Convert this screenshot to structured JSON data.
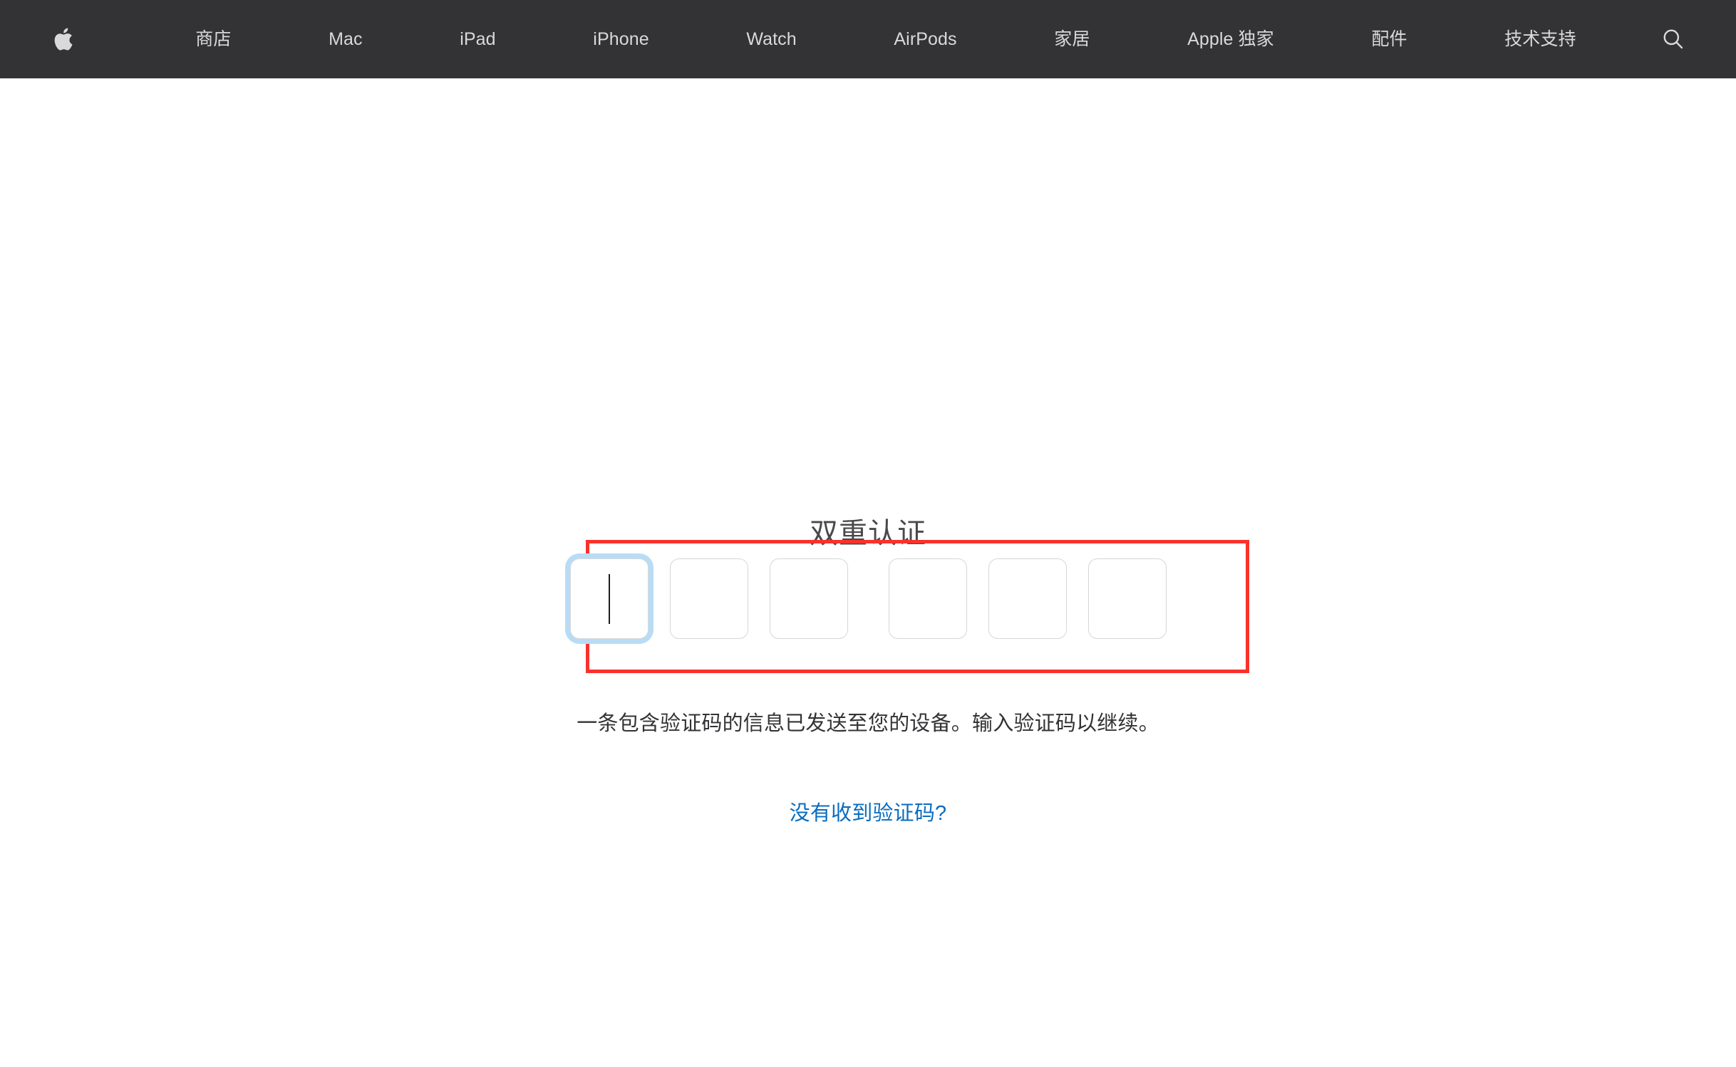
{
  "globalnav": {
    "logo_icon": "apple-logo-icon",
    "search_icon": "search-icon",
    "items": [
      {
        "label": "商店"
      },
      {
        "label": "Mac"
      },
      {
        "label": "iPad"
      },
      {
        "label": "iPhone"
      },
      {
        "label": "Watch"
      },
      {
        "label": "AirPods"
      },
      {
        "label": "家居"
      },
      {
        "label": "Apple 独家"
      },
      {
        "label": "配件"
      },
      {
        "label": "技术支持"
      }
    ],
    "colors": {
      "background": "#333336",
      "text": "#d9d9db"
    }
  },
  "auth": {
    "title": "双重认证",
    "description": "一条包含验证码的信息已发送至您的设备。输入验证码以继续。",
    "link_label": "没有收到验证码?",
    "code_fields": [
      {
        "value": "",
        "focused": true
      },
      {
        "value": "",
        "focused": false
      },
      {
        "value": "",
        "focused": false
      },
      {
        "value": "",
        "focused": false
      },
      {
        "value": "",
        "focused": false
      },
      {
        "value": "",
        "focused": false
      }
    ],
    "colors": {
      "title": "#49494b",
      "description": "#333336",
      "link": "#0a6cc0",
      "field_border": "#d6d6d6",
      "focus_ring": "#b9dcf6"
    }
  },
  "annotation": {
    "type": "highlight-rectangle",
    "color": "#f9322d"
  }
}
